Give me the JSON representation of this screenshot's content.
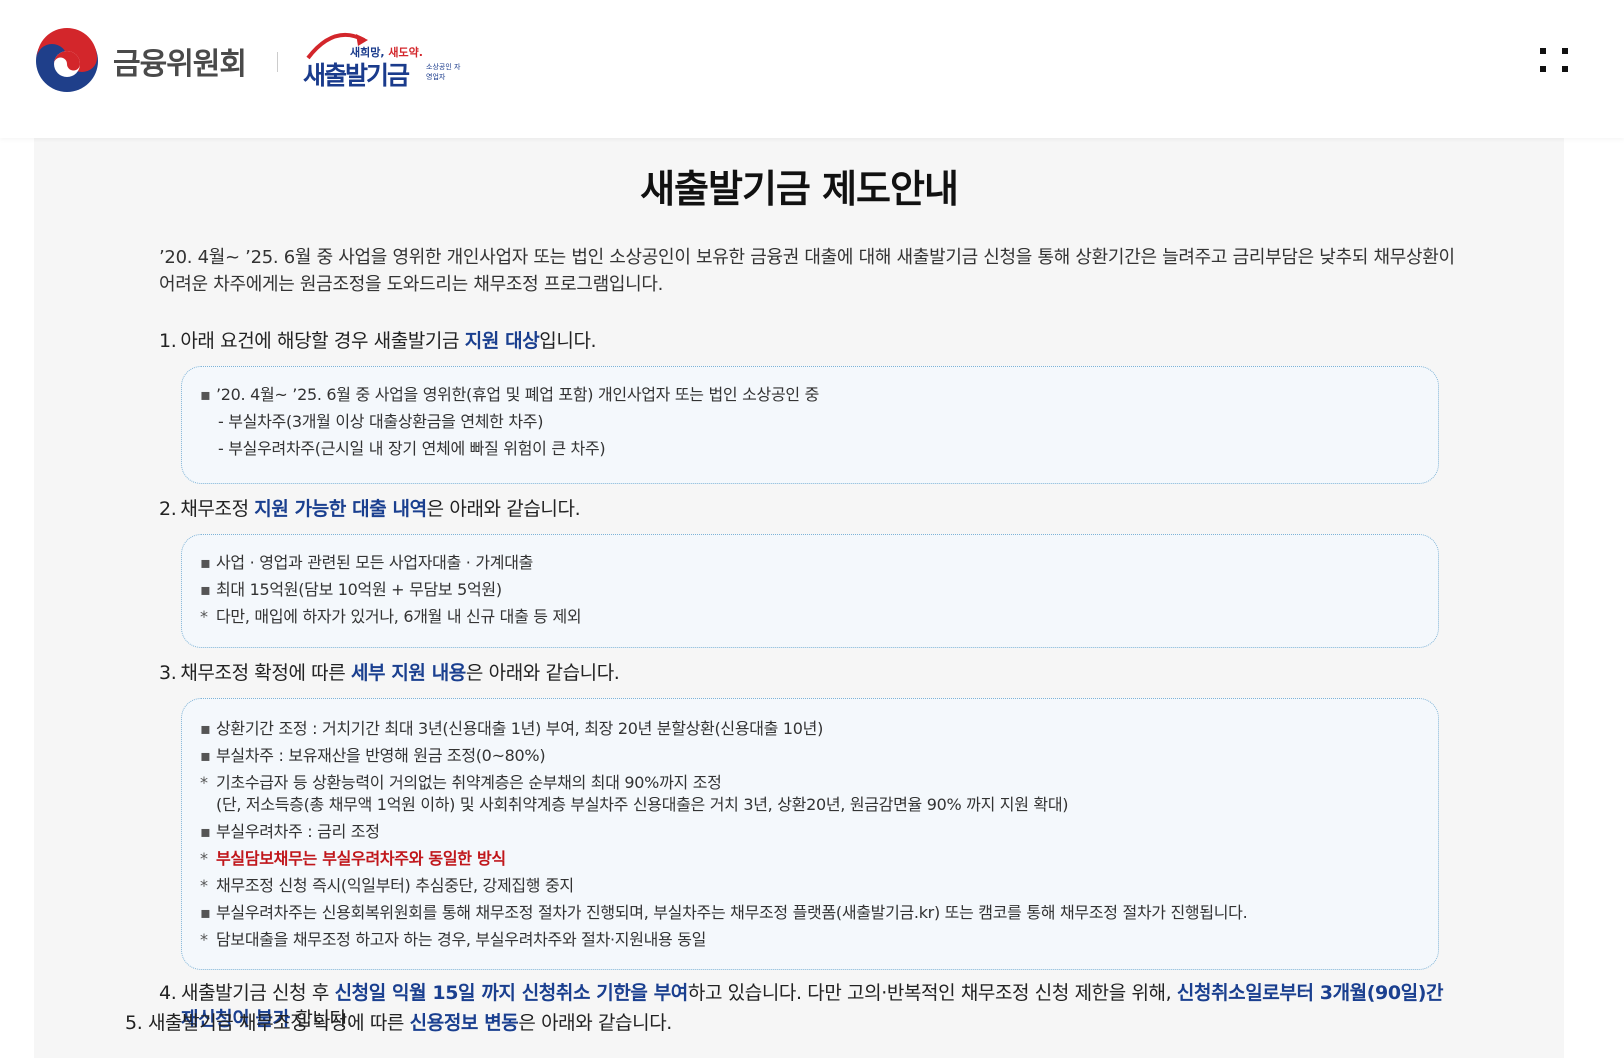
{
  "header": {
    "org_name": "금융위원회",
    "fund_slogan_1": "새희망,",
    "fund_slogan_2": "새도약.",
    "fund_name": "새출발기금",
    "fund_sub": "소상공인 자영업자",
    "menu_icon": "grid-icon"
  },
  "page": {
    "title": "새출발기금 제도안내",
    "intro": "’20. 4월~ ’25. 6월 중 사업을 영위한 개인사업자 또는 법인 소상공인이 보유한 금융권 대출에 대해 새출발기금 신청을 통해 상환기간은 늘려주고 금리부담은 낮추되 채무상환이 어려운 차주에게는 원금조정을 도와드리는 채무조정 프로그램입니다."
  },
  "sections": [
    {
      "num": "1.",
      "pre": "아래 요건에 해당할 경우 새출발기금 ",
      "highlight": "지원 대상",
      "post": "입니다.",
      "lines": [
        {
          "mark": "▪",
          "text": "’20. 4월~ ’25. 6월 중 사업을 영위한(휴업 및 폐업 포함) 개인사업자 또는 법인 소상공인 중"
        },
        {
          "mark": "",
          "text": "- 부실차주(3개월 이상 대출상환금을 연체한 차주)"
        },
        {
          "mark": "",
          "text": "- 부실우려차주(근시일 내 장기 연체에 빠질 위험이 큰 차주)"
        }
      ]
    },
    {
      "num": "2.",
      "pre": "채무조정 ",
      "highlight": "지원 가능한 대출 내역",
      "post": "은 아래와 같습니다.",
      "lines": [
        {
          "mark": "▪",
          "text": "사업 · 영업과 관련된 모든 사업자대출 · 가계대출"
        },
        {
          "mark": "▪",
          "text": "최대 15억원(담보 10억원 + 무담보 5억원)"
        },
        {
          "mark": "*",
          "text": "다만, 매입에 하자가 있거나, 6개월 내 신규 대출 등 제외"
        }
      ]
    },
    {
      "num": "3.",
      "pre": "채무조정 확정에 따른 ",
      "highlight": "세부 지원 내용",
      "post": "은 아래와 같습니다.",
      "lines": [
        {
          "mark": "▪",
          "text": "상환기간 조정 : 거치기간 최대 3년(신용대출 1년) 부여, 최장 20년 분할상환(신용대출 10년)"
        },
        {
          "mark": "▪",
          "text": "부실차주 : 보유재산을 반영해 원금 조정(0~80%)"
        },
        {
          "mark": "*",
          "text": "기초수급자 등 상환능력이 거의없는 취약계층은 순부채의 최대 90%까지 조정"
        },
        {
          "mark": "",
          "text": "(단, 저소득층(총 채무액 1억원 이하) 및 사회취약계층 부실차주 신용대출은 거치 3년, 상환20년, 원금감면율 90% 까지 지원 확대)"
        },
        {
          "mark": "▪",
          "text": "부실우려차주 : 금리 조정"
        },
        {
          "mark": "*",
          "text": "부실담보채무는 부실우려차주와 동일한 방식"
        },
        {
          "mark": "*",
          "text": "채무조정 신청 즉시(익일부터) 추심중단, 강제집행 중지"
        },
        {
          "mark": "▪",
          "text": "부실우려차주는 신용회복위원회를 통해 채무조정 절차가 진행되며, 부실차주는 채무조정 플랫폼(새출발기금.kr) 또는 캠코를 통해 채무조정 절차가 진행됩니다."
        },
        {
          "mark": "*",
          "text": "담보대출을 채무조정 하고자 하는 경우, 부실우려차주와 절차·지원내용 동일"
        }
      ]
    }
  ],
  "section4": {
    "num": "4.",
    "t1": "새출발기금 신청 후 ",
    "h1": "신청일 익월 15일 까지 신청취소 기한을 부여",
    "t2": "하고 있습니다. 다만 고의·반복적인 채무조정 신청 제한을 위해, ",
    "h2": "신청취소일로부터 3개월(90일)간 재신청이 불가",
    "t3": " 합니다."
  },
  "section5": {
    "num": "5.",
    "pre": "새출발기금 채무조정 확정에 따른 ",
    "highlight": "신용정보 변동",
    "post": "은 아래와 같습니다."
  },
  "colors": {
    "accent_blue": "#1a3f8f",
    "accent_red": "#c0161b",
    "box_border": "#7fb3d6"
  }
}
